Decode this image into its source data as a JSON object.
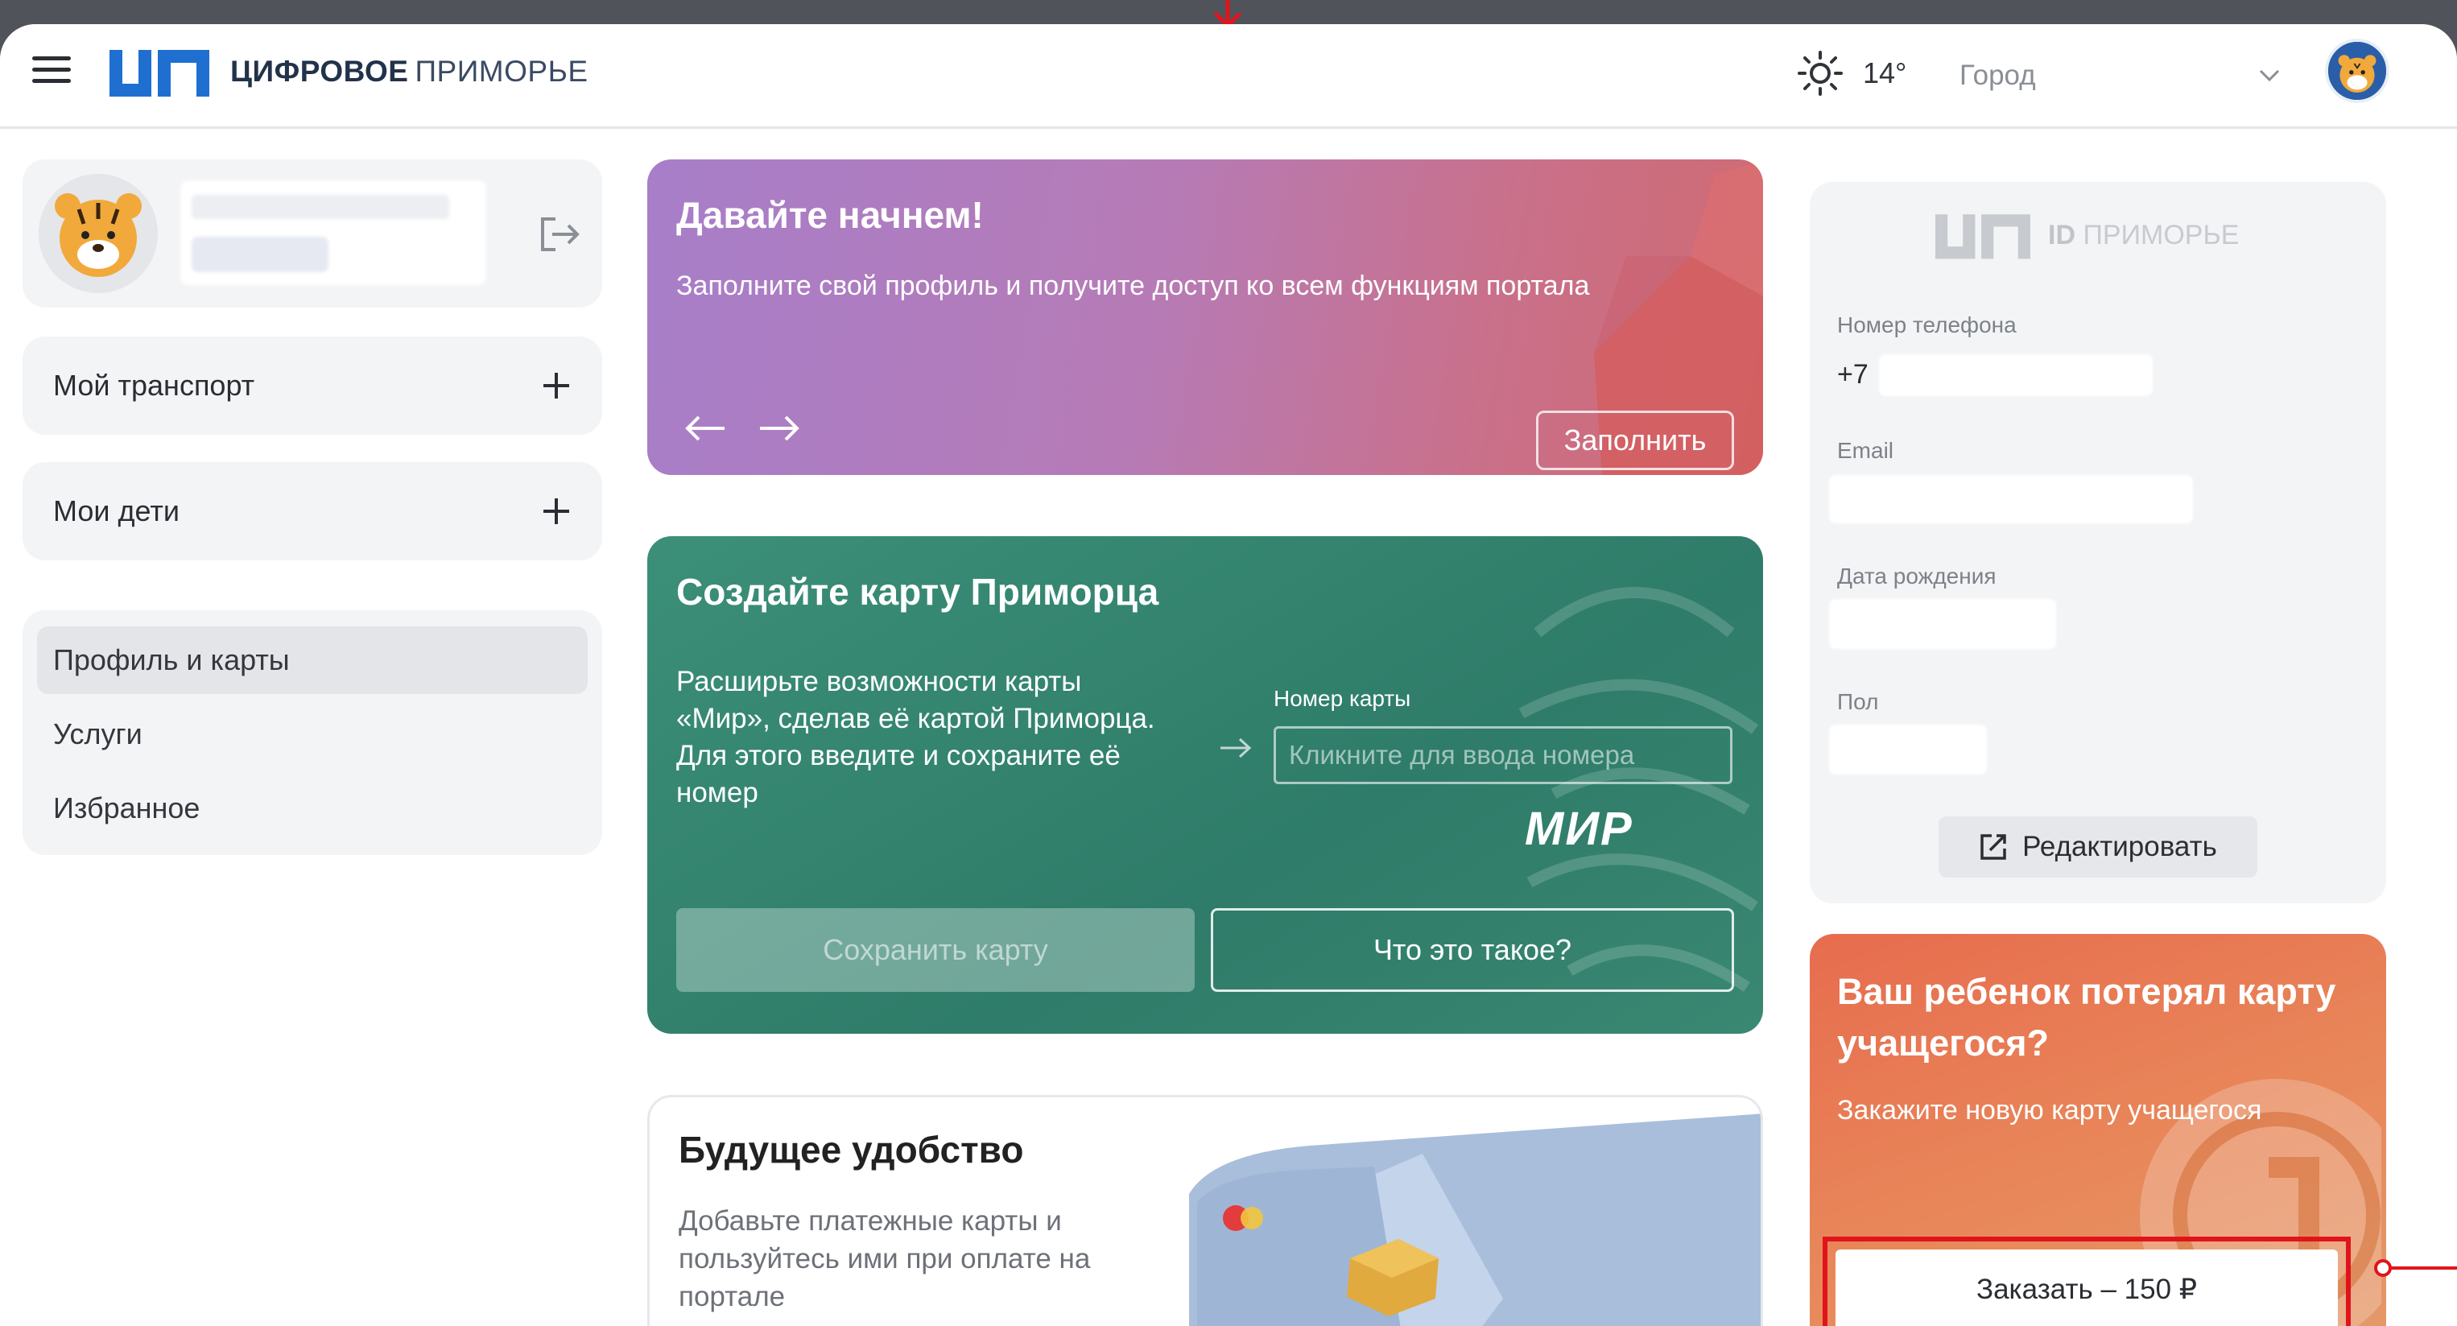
{
  "header": {
    "logo_bold": "ЦИФРОВОЕ",
    "logo_light": "ПРИМОРЬЕ",
    "temperature": "14°",
    "city_placeholder": "Город"
  },
  "sidebar": {
    "transport_label": "Мой транспорт",
    "children_label": "Мои дети",
    "nav": [
      {
        "label": "Профиль и карты",
        "active": true
      },
      {
        "label": "Услуги",
        "active": false
      },
      {
        "label": "Избранное",
        "active": false
      }
    ]
  },
  "banner_start": {
    "title": "Давайте начнем!",
    "subtitle": "Заполните свой профиль и получите доступ ко всем функциям портала",
    "button": "Заполнить"
  },
  "banner_card": {
    "title": "Создайте карту Приморца",
    "text": "Расширьте возможности карты «Мир», сделав её картой Приморца. Для этого введите и сохраните её номер",
    "field_label": "Номер карты",
    "field_placeholder": "Кликните для ввода номера",
    "brand": "МИР",
    "save_button": "Сохранить карту",
    "what_button": "Что это такое?"
  },
  "banner_future": {
    "title": "Будущее удобство",
    "text": "Добавьте платежные карты и пользуйтесь ими при оплате на портале"
  },
  "id_panel": {
    "logo_bold": "ID",
    "logo_light": "ПРИМОРЬЕ",
    "phone_label": "Номер телефона",
    "phone_prefix": "+7",
    "email_label": "Email",
    "birth_label": "Дата рождения",
    "gender_label": "Пол",
    "edit_button": "Редактировать"
  },
  "banner_child": {
    "title": "Ваш ребенок потерял карту учащегося?",
    "subtitle": "Закажите новую карту учащегося",
    "button": "Заказать – 150 ₽"
  },
  "colors": {
    "brand_blue": "#1f6fd1",
    "purple_banner": "#b67bb6",
    "green_banner": "#2e7c69",
    "orange_banner": "#e8885a",
    "highlight_red": "#e0141b"
  }
}
